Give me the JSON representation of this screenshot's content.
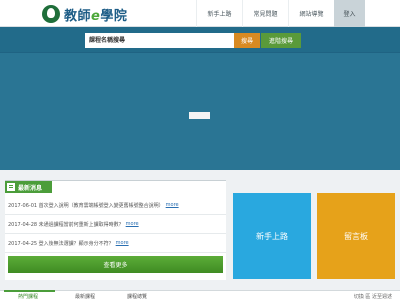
{
  "header": {
    "logo_text_prefix": "教師",
    "logo_text_e": "e",
    "logo_text_suffix": "學院",
    "nav": [
      "新手上路",
      "常見問題",
      "網站導覽"
    ],
    "login": "登入"
  },
  "search": {
    "placeholder": "課程名稱搜尋",
    "search_button": "搜尋",
    "advanced_button": "進階搜尋"
  },
  "news": {
    "title": "最新消息",
    "items": [
      {
        "text": "2017-06-01 首次登入說明（教育雲端帳號登入變更舊帳號整合說明）",
        "more": "more"
      },
      {
        "text": "2017-04-28 未通過課程當前何重新上課取得時數？",
        "more": "more"
      },
      {
        "text": "2017-04-25 登入後無法選課？顯示身分不符？",
        "more": "more"
      }
    ],
    "more_all": "查看更多"
  },
  "tiles": {
    "beginner": "新手上路",
    "board": "留言板"
  },
  "bottom_tabs": {
    "tabs": [
      "熱門課程",
      "最新課程",
      "課程總覽"
    ],
    "right": "切換  區  近至週述"
  },
  "colors": {
    "hero": "#2a7594",
    "accent_green": "#4b9d3a",
    "search_orange": "#d88a22",
    "tile_blue": "#29a8df",
    "tile_orange": "#e6a21a"
  }
}
